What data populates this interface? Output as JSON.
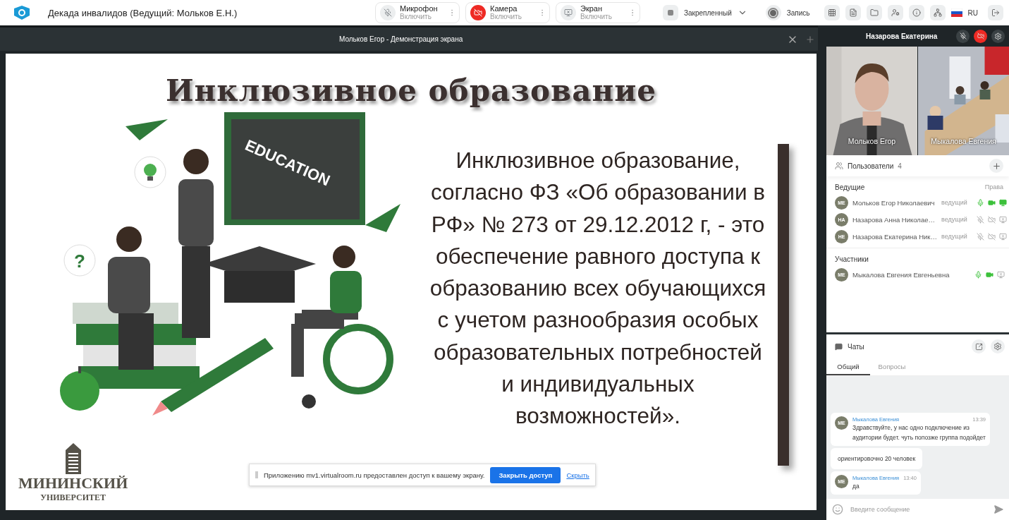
{
  "header": {
    "title": "Декада инвалидов (Ведущий: Мольков Е.Н.)"
  },
  "media_controls": [
    {
      "kind": "mic",
      "label": "Микрофон",
      "action": "Включить",
      "alert": false
    },
    {
      "kind": "camera",
      "label": "Камера",
      "action": "Включить",
      "alert": true
    },
    {
      "kind": "screen",
      "label": "Экран",
      "action": "Включить",
      "alert": false
    }
  ],
  "layout_menu": {
    "label": "Закрепленный"
  },
  "record": {
    "label": "Запись"
  },
  "toolbar_icons": [
    {
      "kind": "grid"
    },
    {
      "kind": "notes"
    },
    {
      "kind": "folder"
    },
    {
      "kind": "user-settings"
    },
    {
      "kind": "info"
    },
    {
      "kind": "network"
    }
  ],
  "language": {
    "label": "RU"
  },
  "screen_share": {
    "title": "Мольков Егор - Демонстрация экрана",
    "slide": {
      "title": "Инклюзивное образование",
      "body": "Инклюзивное образование, согласно ФЗ «Об образовании в РФ» № 273 от 29.12.2012 г, - это обеспечение равного доступа к образованию всех обучающихся с учетом разнообразия особых образовательных потребностей и индивидуальных возможностей».",
      "board_text": "EDUCATION",
      "badge_text": "?",
      "logo": {
        "line_1": "МИНИНСКИЙ",
        "line_2": "УНИВЕРСИТЕТ"
      }
    },
    "notice": {
      "text": "Приложению mv1.virtualroom.ru предоставлен доступ к вашему экрану.",
      "button": "Закрыть доступ",
      "link": "Скрыть"
    }
  },
  "sidebar": {
    "pinned_user": "Назарова Екатерина",
    "videos": [
      {
        "name": "Мольков Егор"
      },
      {
        "name": "Мыкалова Евгения"
      }
    ],
    "users": {
      "title": "Пользователи",
      "count": "4",
      "groups": [
        {
          "title": "Ведущие",
          "rights_label": "Права",
          "members": [
            {
              "initials": "МЕ",
              "name": "Мольков Егор Николаевич",
              "role": "ведущий",
              "mic_on": true,
              "cam_on": true,
              "screen_on": true
            },
            {
              "initials": "НА",
              "name": "Назарова Анна Николае…",
              "role": "ведущий",
              "mic_on": false,
              "cam_on": false,
              "screen_on": false
            },
            {
              "initials": "НЕ",
              "name": "Назарова Екатерина Ник…",
              "role": "ведущий",
              "mic_on": false,
              "cam_on": false,
              "screen_on": false
            }
          ]
        },
        {
          "title": "Участники",
          "members": [
            {
              "initials": "МЕ",
              "name": "Мыкалова Евгения Евгеньевна",
              "mic_on": true,
              "cam_on": true,
              "screen_on": false
            }
          ]
        }
      ]
    },
    "chat": {
      "title": "Чаты",
      "tabs": [
        {
          "label": "Общий",
          "selected": true
        },
        {
          "label": "Вопросы",
          "selected": false
        }
      ],
      "messages": [
        {
          "kind": "full",
          "initials": "МЕ",
          "author": "Мыкалова Евгения",
          "time": "13:39",
          "text": "Здравствуйте, у нас одно подключение из аудитории будет. чуть попозже группа подойдет"
        },
        {
          "kind": "continuation",
          "text": "ориентировочно 20 человек"
        },
        {
          "kind": "full",
          "initials": "МЕ",
          "author": "Мыкалова Евгения",
          "time": "13:40",
          "text": "да"
        }
      ],
      "input": {
        "placeholder": "Введите сообщение"
      }
    }
  }
}
